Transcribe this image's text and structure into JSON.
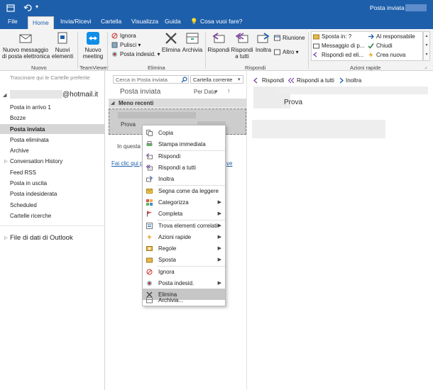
{
  "window": {
    "title": "Posta inviata -"
  },
  "tabs": [
    "File",
    "Home",
    "Invia/Ricevi",
    "Cartella",
    "Visualizza",
    "Guida"
  ],
  "tellme": "Cosa vuoi fare?",
  "ribbon": {
    "nuovo": {
      "new_email": "Nuovo messaggio\ndi posta elettronica",
      "new_items": "Nuovi\nelementi",
      "group": "Nuovo"
    },
    "teamviewer": {
      "meeting": "Nuovo\nmeeting",
      "group": "TeamViewer"
    },
    "elimina": {
      "ignora": "Ignora",
      "pulisci": "Pulisci",
      "indesid": "Posta indesid.",
      "elimina": "Elimina",
      "archivia": "Archivia",
      "group": "Elimina"
    },
    "rispondi": {
      "rispondi": "Rispondi",
      "rispondi_tutti": "Rispondi\na tutti",
      "inoltra": "Inoltra",
      "riunione": "Riunione",
      "altro": "Altro",
      "group": "Rispondi"
    },
    "azioni": {
      "sposta_in": "Sposta in: ?",
      "messaggio": "Messaggio di p...",
      "rispondi_el": "Rispondi ed eli...",
      "responsabile": "Al responsabile",
      "chiudi": "Chiudi",
      "crea_nuova": "Crea nuova",
      "group": "Azioni rapide"
    }
  },
  "nav": {
    "favorites_hint": "Trascinare qui le Cartelle preferite",
    "account": "@hotmail.it",
    "folders": [
      "Posta in arrivo  1",
      "Bozze",
      "Posta inviata",
      "Posta eliminata",
      "Archive",
      "Conversation History",
      "Feed RSS",
      "Posta in uscita",
      "Posta indesiderata",
      "Scheduled",
      "Cartelle ricerche"
    ],
    "data_file": "File di dati di Outlook"
  },
  "list": {
    "search_placeholder": "Cerca in Posta inviata",
    "scope": "Cartella corrente",
    "folder_title": "Posta inviata",
    "sort": "Per Data",
    "group_header": "Meno recenti",
    "message_subject": "Prova",
    "info_text": "In questa c",
    "link_left": "Fai clic qui pe",
    "link_right": "ve"
  },
  "reading": {
    "reply": "Rispondi",
    "reply_all": "Rispondi a tutti",
    "forward": "Inoltra",
    "subject": "Prova"
  },
  "context_menu": [
    {
      "label": "Copia",
      "icon": "copy-icon",
      "arrow": false
    },
    {
      "label": "Stampa immediata",
      "icon": "print-icon",
      "arrow": false
    },
    {
      "label": "Rispondi",
      "icon": "reply-icon",
      "arrow": false
    },
    {
      "label": "Rispondi a tutti",
      "icon": "reply-all-icon",
      "arrow": false
    },
    {
      "label": "Inoltra",
      "icon": "forward-icon",
      "arrow": false
    },
    {
      "label": "Segna come da leggere",
      "icon": "envelope-icon",
      "arrow": false
    },
    {
      "label": "Categorizza",
      "icon": "category-icon",
      "arrow": true
    },
    {
      "label": "Completa",
      "icon": "flag-icon",
      "arrow": true
    },
    {
      "label": "Trova elementi correlati",
      "icon": "find-related-icon",
      "arrow": true
    },
    {
      "label": "Azioni rapide",
      "icon": "lightning-icon",
      "arrow": true
    },
    {
      "label": "Regole",
      "icon": "rules-icon",
      "arrow": true
    },
    {
      "label": "Sposta",
      "icon": "move-icon",
      "arrow": true
    },
    {
      "label": "Ignora",
      "icon": "ignore-icon",
      "arrow": false
    },
    {
      "label": "Posta indesid.",
      "icon": "junk-icon",
      "arrow": true
    },
    {
      "label": "Elimina",
      "icon": "delete-icon",
      "arrow": false
    },
    {
      "label": "Archivia...",
      "icon": "archive-icon",
      "arrow": false
    }
  ],
  "colors": {
    "accent": "#1e5fab",
    "selected": "#cdcdcd",
    "hover": "#c6c6c6"
  }
}
